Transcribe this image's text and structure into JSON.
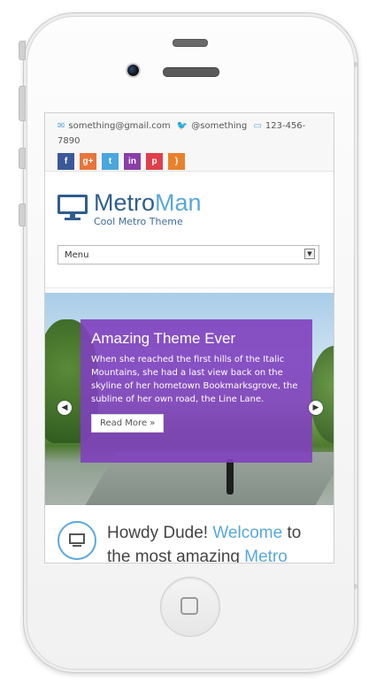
{
  "contact": {
    "email": "something@gmail.com",
    "twitter": "@something",
    "phone": "123-456-7890"
  },
  "social": [
    {
      "icon": "facebook-icon",
      "glyph": "f",
      "color": "#3b5998"
    },
    {
      "icon": "google-plus-icon",
      "glyph": "g+",
      "color": "#e8743b"
    },
    {
      "icon": "twitter-icon",
      "glyph": "t",
      "color": "#4aa6dc"
    },
    {
      "icon": "linkedin-icon",
      "glyph": "in",
      "color": "#8a3fa8"
    },
    {
      "icon": "pinterest-icon",
      "glyph": "p",
      "color": "#e0404b"
    },
    {
      "icon": "rss-icon",
      "glyph": ")",
      "color": "#e9812c"
    }
  ],
  "logo": {
    "part1": "Metro",
    "part2": "Man",
    "tagline": "Cool Metro Theme"
  },
  "menu": {
    "label": "Menu"
  },
  "slide": {
    "title": "Amazing Theme Ever",
    "text": "When she reached the first hills of the Italic Mountains, she had a last view back on the skyline of her hometown Bookmarksgrove, the subline of her own road, the Line Lane.",
    "button": "Read More »"
  },
  "welcome": {
    "part1": "Howdy Dude! ",
    "part2": "Welcome",
    "part3": " to the most amazing ",
    "part4": "Metro"
  },
  "colors": {
    "brand": "#2f5e8e",
    "accent": "#5aa8db",
    "slide": "#8040be"
  }
}
